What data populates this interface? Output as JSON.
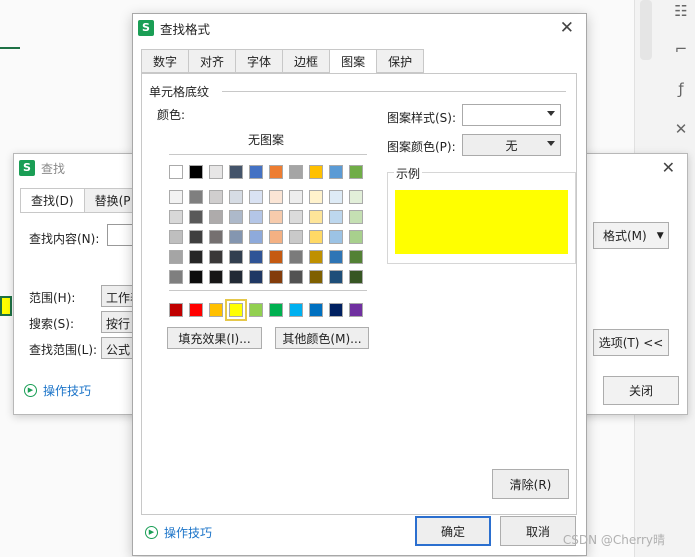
{
  "find_dialog": {
    "title": "查找",
    "tabs": [
      "查找(D)",
      "替换(P"
    ],
    "find_content_label": "查找内容(N):",
    "scope_label": "范围(H):",
    "scope_value": "工作表",
    "search_label": "搜索(S):",
    "search_value": "按行",
    "lookin_label": "查找范围(L):",
    "lookin_value": "公式",
    "format_button": "格式(M)",
    "options_button": "选项(T) <<",
    "close_button": "关闭",
    "tips_link": "操作技巧"
  },
  "format_dialog": {
    "title": "查找格式",
    "tabs": [
      "数字",
      "对齐",
      "字体",
      "边框",
      "图案",
      "保护"
    ],
    "active_tab": "图案",
    "group_label": "单元格底纹",
    "color_label": "颜色:",
    "no_pattern": "无图案",
    "fill_effects_button": "填充效果(I)...",
    "more_colors_button": "其他颜色(M)...",
    "pattern_style_label": "图案样式(S):",
    "pattern_style_value": "",
    "pattern_color_label": "图案颜色(P):",
    "pattern_color_value": "无",
    "sample_label": "示例",
    "sample_color": "#ffff00",
    "clear_button": "清除(R)",
    "ok_button": "确定",
    "cancel_button": "取消",
    "tips_link": "操作技巧",
    "selected_color": "#ffff00"
  },
  "palette": {
    "row_top": [
      "#ffffff",
      "#000000",
      "#e7e6e6",
      "#44546a",
      "#4472c4",
      "#ed7d31",
      "#a5a5a5",
      "#ffc000",
      "#5b9bd5",
      "#70ad47"
    ],
    "shades": [
      [
        "#f2f2f2",
        "#7f7f7f",
        "#d0cece",
        "#d6dce4",
        "#d9e2f3",
        "#fbe5d5",
        "#ededed",
        "#fff2cc",
        "#deebf6",
        "#e2efd9"
      ],
      [
        "#d8d8d8",
        "#595959",
        "#aeabab",
        "#adb9ca",
        "#b4c6e7",
        "#f7cbac",
        "#dbdbdb",
        "#fee599",
        "#bdd7ee",
        "#c5e0b3"
      ],
      [
        "#bfbfbf",
        "#3f3f3f",
        "#757070",
        "#8496b0",
        "#8eaadb",
        "#f4b183",
        "#c9c9c9",
        "#ffd965",
        "#9cc3e5",
        "#a8d08d"
      ],
      [
        "#a5a5a5",
        "#262626",
        "#3a3838",
        "#323f4f",
        "#2f5496",
        "#c55a11",
        "#7b7b7b",
        "#bf9000",
        "#2e75b5",
        "#538135"
      ],
      [
        "#7f7f7f",
        "#0c0c0c",
        "#171616",
        "#222a35",
        "#1f3864",
        "#833c0b",
        "#525252",
        "#7f6000",
        "#1e4e79",
        "#375623"
      ]
    ],
    "row_standard": [
      "#c00000",
      "#ff0000",
      "#ffc000",
      "#ffff00",
      "#92d050",
      "#00b050",
      "#00b0f0",
      "#0070c0",
      "#002060",
      "#7030a0"
    ]
  },
  "watermark": "CSDN @Cherry晴"
}
